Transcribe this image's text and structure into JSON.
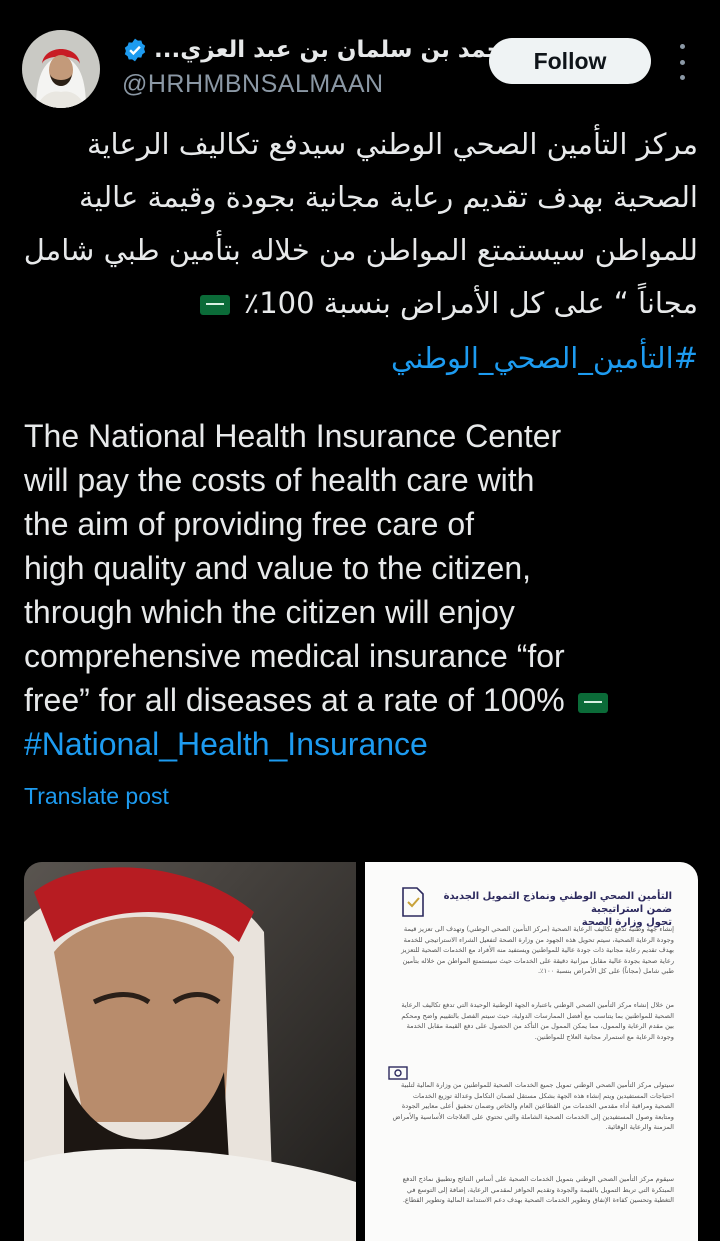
{
  "author": {
    "display_name": "محمد بن سلمان بن عبد العزي...",
    "handle": "@HRHMBNSALMAAN",
    "verified": true
  },
  "actions": {
    "follow_label": "Follow",
    "more_icon": "more-vertical-icon"
  },
  "post": {
    "arabic_lines": [
      "مركز التأمين الصحي الوطني سيدفع تكاليف الرعاية",
      "الصحية بهدف تقديم رعاية مجانية بجودة وقيمة عالية",
      "للمواطن سيستمتع المواطن من خلاله بتأمين طبي شامل",
      "مجاناً “ على كل الأمراض بنسبة 100٪"
    ],
    "arabic_hashtag": "#التأمين_الصحي_الوطني",
    "english_lines": [
      "The National Health Insurance Center",
      "will pay the costs of health care with",
      "the aim of providing free care of",
      "high quality and value to the citizen,",
      "through which the citizen will enjoy",
      "comprehensive medical insurance “for",
      "free” for all diseases at a rate of 100%"
    ],
    "english_hashtag": "#National_Health_Insurance",
    "flag_emoji": "saudi-flag-icon",
    "translate_label": "Translate post"
  },
  "media": {
    "document": {
      "title_line1": "التأمين الصحي الوطني ونماذج التمويل الجديدة ضمن استراتيجية",
      "title_line2": "تحول وزارة الصحة",
      "para1": "إنشاء جهة وطنية تدفع تكاليف الرعاية الصحية (مركز التأمين الصحي الوطني) وتهدف الى تعزيز قيمة وجودة الرعاية الصحية، سيتم تحويل هذه الجهود من وزارة الصحة لتفعيل الشراء الاستراتيجي للخدمة بهدف تقديم رعاية مجانية ذات جودة عالية للمواطنين ويستفيد منه الأفراد مع الخدمات الصحية للتعزيز رعاية صحية بجودة عالية مقابل ميزانية دقيقة على الخدمات حيث سيستمتع المواطن من خلاله بتأمين طبي شامل (مجاناً) على كل الأمراض بنسبة ١٠٠٪.",
      "para2": "من خلال إنشاء مركز التأمين الصحي الوطني باعتباره الجهة الوطنية الوحيدة التي تدفع تكاليف الرعاية الصحية للمواطنين بما يتناسب مع أفضل الممارسات الدولية، حيث سيتم الفصل بالتقييم واضح ومحكم بين مقدم الرعاية والممول، مما يمكن الممول من التأكد من الحصول على دفع القيمة مقابل الخدمة وجودة الرعاية مع استمرار مجانية العلاج للمواطنين.",
      "para3": "سيتولى مركز التأمين الصحي الوطني تمويل جميع الخدمات الصحية للمواطنين من وزارة المالية لتلبية احتياجات المستفيدين ويتم إنشاء هذه الجهة بشكل مستقل لضمان التكامل وعدالة توزيع الخدمات الصحية ومراقبة أداء مقدمي الخدمات من القطاعين العام والخاص وضمان تحقيق أعلى معايير الجودة ومتابعة وصول المستفيدين إلى الخدمات الصحية الشاملة والتي تحتوي على العلاجات الأساسية والأمراض المزمنة والرعاية الوقائية.",
      "para4": "سيقوم مركز التأمين الصحي الوطني بتمويل الخدمات الصحية على أساس النتائج وتطبيق نماذج الدفع المبتكرة التي تربط التمويل بالقيمة والجودة وتقديم الحوافز لمقدمي الرعاية، إضافة إلى التوسع في التغطية وتحسين كفاءة الإنفاق وتطوير الخدمات الصحية بهدف دعم الاستدامة المالية وتطوير القطاع."
    }
  }
}
